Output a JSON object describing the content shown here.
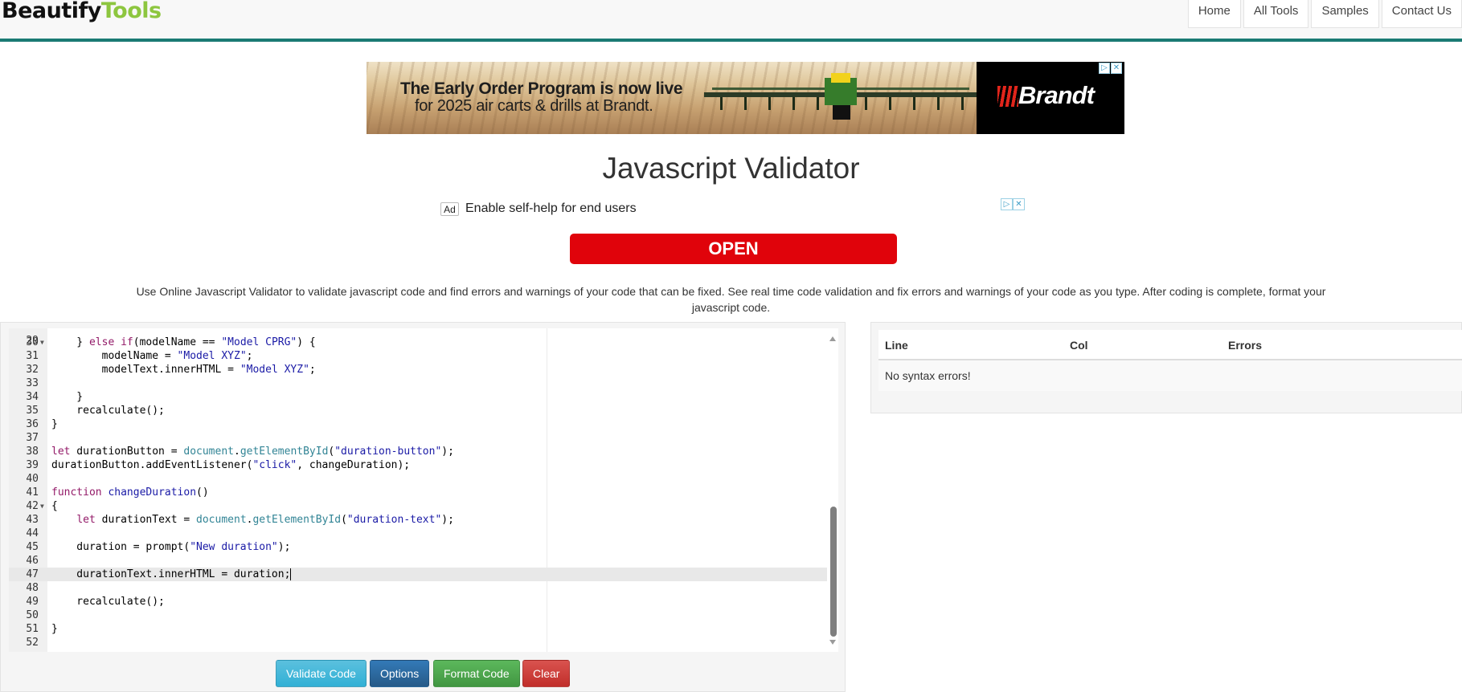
{
  "header": {
    "logo_part1": "Beautify",
    "logo_part2": "Tools",
    "nav": [
      "Home",
      "All Tools",
      "Samples",
      "Contact Us"
    ]
  },
  "banner_ad": {
    "headline": "The Early Order Program is now live",
    "subline": "for 2025 air carts & drills at Brandt.",
    "brand": "Brandt"
  },
  "page_title": "Javascript Validator",
  "text_ad": {
    "badge": "Ad",
    "text": "Enable self-help for end users",
    "button": "OPEN"
  },
  "description": "Use Online Javascript Validator to validate javascript code and find errors and warnings of your code that can be fixed. See real time code validation and fix errors and warnings of your code as you type. After coding is complete, format your javascript code.",
  "editor": {
    "top_partial_line": "29",
    "active_line": 47,
    "lines": [
      {
        "n": "30",
        "fold": true,
        "html": "    } <span class=\"kw\">else</span> <span class=\"kw\">if</span>(modelName == <span class=\"str\">\"Model CPRG\"</span>) {"
      },
      {
        "n": "31",
        "fold": false,
        "html": "        modelName = <span class=\"str\">\"Model XYZ\"</span>;"
      },
      {
        "n": "32",
        "fold": false,
        "html": "        modelText.innerHTML = <span class=\"str\">\"Model XYZ\"</span>;"
      },
      {
        "n": "33",
        "fold": false,
        "html": ""
      },
      {
        "n": "34",
        "fold": false,
        "html": "    }"
      },
      {
        "n": "35",
        "fold": false,
        "html": "    recalculate();"
      },
      {
        "n": "36",
        "fold": false,
        "html": "}"
      },
      {
        "n": "37",
        "fold": false,
        "html": ""
      },
      {
        "n": "38",
        "fold": false,
        "html": "<span class=\"kw\">let</span> durationButton = <span class=\"obj\">document</span>.<span class=\"obj\">getElementById</span>(<span class=\"str\">\"duration-button\"</span>);"
      },
      {
        "n": "39",
        "fold": false,
        "html": "durationButton.addEventListener(<span class=\"str\">\"click\"</span>, changeDuration);"
      },
      {
        "n": "40",
        "fold": false,
        "html": ""
      },
      {
        "n": "41",
        "fold": false,
        "html": "<span class=\"kw\">function</span> <span class=\"fn\">changeDuration</span>()"
      },
      {
        "n": "42",
        "fold": true,
        "html": "{"
      },
      {
        "n": "43",
        "fold": false,
        "html": "    <span class=\"kw\">let</span> durationText = <span class=\"obj\">document</span>.<span class=\"obj\">getElementById</span>(<span class=\"str\">\"duration-text\"</span>);"
      },
      {
        "n": "44",
        "fold": false,
        "html": ""
      },
      {
        "n": "45",
        "fold": false,
        "html": "    duration = prompt(<span class=\"str\">\"New duration\"</span>);"
      },
      {
        "n": "46",
        "fold": false,
        "html": ""
      },
      {
        "n": "47",
        "fold": false,
        "html": "    durationText.innerHTML = duration;<span class=\"cursor\"></span>"
      },
      {
        "n": "48",
        "fold": false,
        "html": ""
      },
      {
        "n": "49",
        "fold": false,
        "html": "    recalculate();"
      },
      {
        "n": "50",
        "fold": false,
        "html": ""
      },
      {
        "n": "51",
        "fold": false,
        "html": "}"
      },
      {
        "n": "52",
        "fold": false,
        "html": ""
      }
    ]
  },
  "buttons": {
    "validate": "Validate Code",
    "options": "Options",
    "format": "Format Code",
    "clear": "Clear"
  },
  "results": {
    "headers": [
      "Line",
      "Col",
      "Errors"
    ],
    "message": "No syntax errors!"
  },
  "colors": {
    "accent_teal": "#1a7a74",
    "logo_green": "#8dc63f",
    "open_red": "#e0030b"
  }
}
